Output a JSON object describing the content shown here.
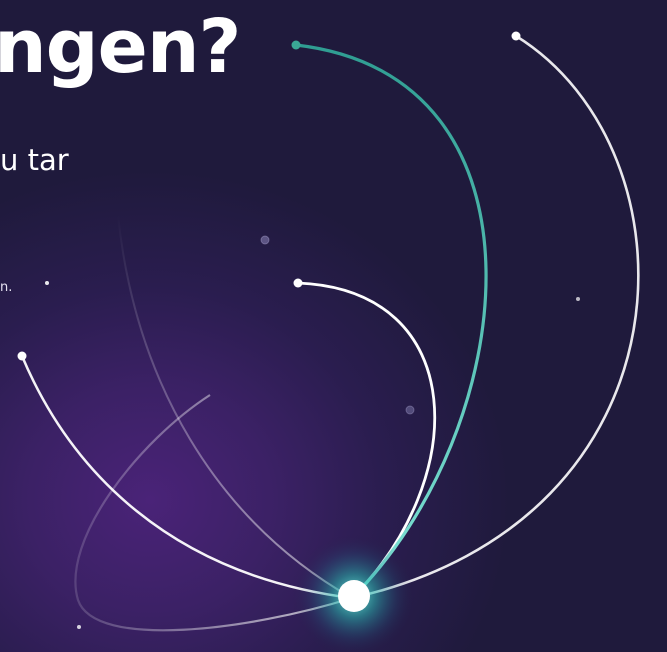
{
  "hero": {
    "headline": "ngen?",
    "subline": "u tar",
    "smalltext": "n."
  },
  "colors": {
    "background": "#1e1a3a",
    "glow": "#4a2378",
    "teal_arc": "#2fa69a",
    "white_arc": "#ffffff"
  },
  "icons": {
    "central_orb": "glowing-orb-icon"
  }
}
